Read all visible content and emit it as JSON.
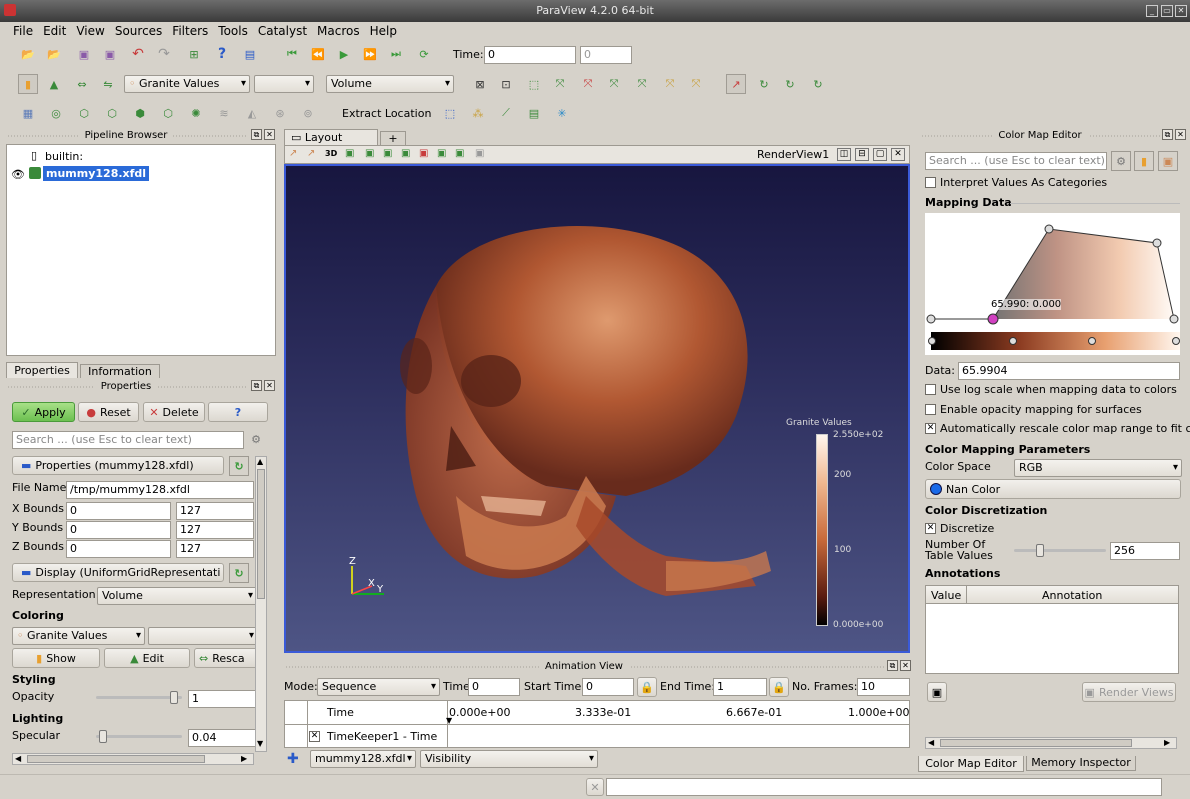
{
  "window": {
    "title": "ParaView 4.2.0 64-bit"
  },
  "menu": [
    "File",
    "Edit",
    "View",
    "Sources",
    "Filters",
    "Tools",
    "Catalyst",
    "Macros",
    "Help"
  ],
  "toolbar": {
    "time_label": "Time:",
    "time_value": "0",
    "time_index": "0",
    "color_by": "Granite Values",
    "representation": "Volume",
    "extract_location": "Extract Location"
  },
  "pipeline": {
    "title": "Pipeline Browser",
    "items": [
      "builtin:",
      "mummy128.xfdl"
    ]
  },
  "tabs": {
    "properties": "Properties",
    "information": "Information"
  },
  "properties": {
    "title": "Properties",
    "apply": "Apply",
    "reset": "Reset",
    "delete": "Delete",
    "help": "?",
    "search_placeholder": "Search ... (use Esc to clear text)",
    "section_props": "Properties (mummy128.xfdl)",
    "file_name_label": "File Name",
    "file_name": "/tmp/mummy128.xfdl",
    "x_label": "X Bounds",
    "x_min": "0",
    "x_max": "127",
    "y_label": "Y Bounds",
    "y_min": "0",
    "y_max": "127",
    "z_label": "Z Bounds",
    "z_min": "0",
    "z_max": "127",
    "section_display": "Display (UniformGridRepresentati",
    "repr_label": "Representation",
    "repr_value": "Volume",
    "coloring": "Coloring",
    "color_by": "Granite Values",
    "show": "Show",
    "edit": "Edit",
    "rescale": "Resca",
    "styling": "Styling",
    "opacity_label": "Opacity",
    "opacity": "1",
    "opacity_level": 0.95,
    "lighting": "Lighting",
    "specular_label": "Specular",
    "specular": "0.04",
    "specular_level": 0.04
  },
  "layout": {
    "tab": "Layout #1",
    "add": "+",
    "view_name": "RenderView1",
    "view_3d": "3D"
  },
  "legend": {
    "title": "Granite Values",
    "max": "2.550e+02",
    "t200": "200",
    "t100": "100",
    "min": "0.000e+00"
  },
  "axes": {
    "z": "Z",
    "x": "X",
    "y": "Y"
  },
  "animation": {
    "title": "Animation View",
    "mode_label": "Mode:",
    "mode": "Sequence",
    "time_label": "Time",
    "time": "0",
    "start_label": "Start Time:",
    "start": "0",
    "end_label": "End Time:",
    "end": "1",
    "frames_label": "No. Frames:",
    "frames": "10",
    "col_time": "Time",
    "ticks": [
      "0.000e+00",
      "3.333e-01",
      "6.667e-01",
      "1.000e+00"
    ],
    "track": "TimeKeeper1 - Time",
    "source": "mummy128.xfdl",
    "property": "Visibility"
  },
  "colormap": {
    "title": "Color Map Editor",
    "search_placeholder": "Search ... (use Esc to clear text)",
    "interpret": "Interpret Values As Categories",
    "mapping_data": "Mapping Data",
    "point_label": "65.990: 0.000",
    "data_label": "Data:",
    "data_value": "65.9904",
    "log_scale": "Use log scale when mapping data to colors",
    "opacity_surfaces": "Enable opacity mapping for surfaces",
    "auto_rescale": "Automatically rescale color map range to fit c",
    "params": "Color Mapping Parameters",
    "space_label": "Color Space",
    "space": "RGB",
    "nan": "Nan Color",
    "discretization": "Color Discretization",
    "discretize": "Discretize",
    "table_values_label": "Number Of Table Values",
    "table_values": "256",
    "annotations": "Annotations",
    "col_value": "Value",
    "col_annotation": "Annotation",
    "render_views": "Render Views"
  },
  "bottom_tabs": {
    "cme": "Color Map Editor",
    "memory": "Memory Inspector"
  }
}
